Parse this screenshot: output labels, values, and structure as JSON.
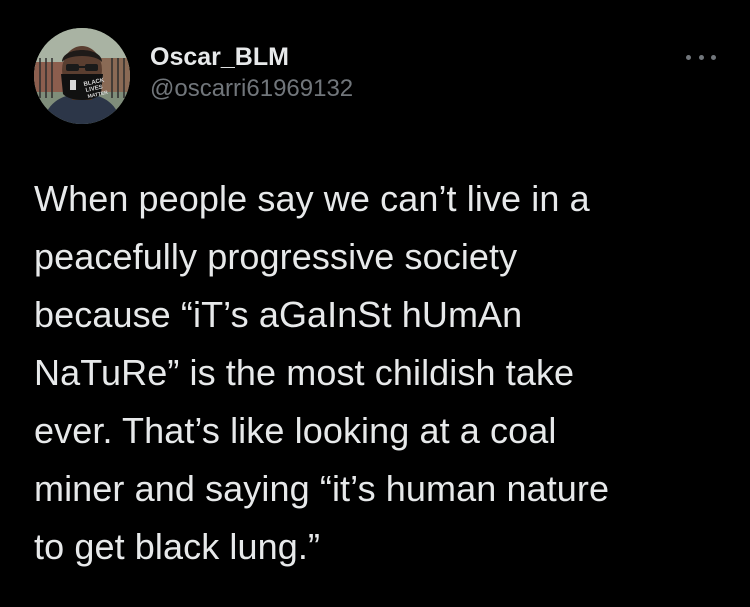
{
  "tweet": {
    "author": {
      "display_name": "Oscar_BLM",
      "handle": "@oscarri61969132",
      "avatar_icon": "profile-photo-icon",
      "mask_text": "BLACK LIVES MATTER"
    },
    "more_icon": "more-options-icon",
    "text": "When people say we can’t live in a\npeacefully progressive society\nbecause “iT’s aGaInSt hUmAn\nNaTuRe” is the most childish take\never. That’s like looking at a coal\nminer and saying “it’s human nature\nto get black lung.”"
  },
  "colors": {
    "background": "#000000",
    "primary_text": "#e7e9ea",
    "secondary_text": "#71767b"
  }
}
